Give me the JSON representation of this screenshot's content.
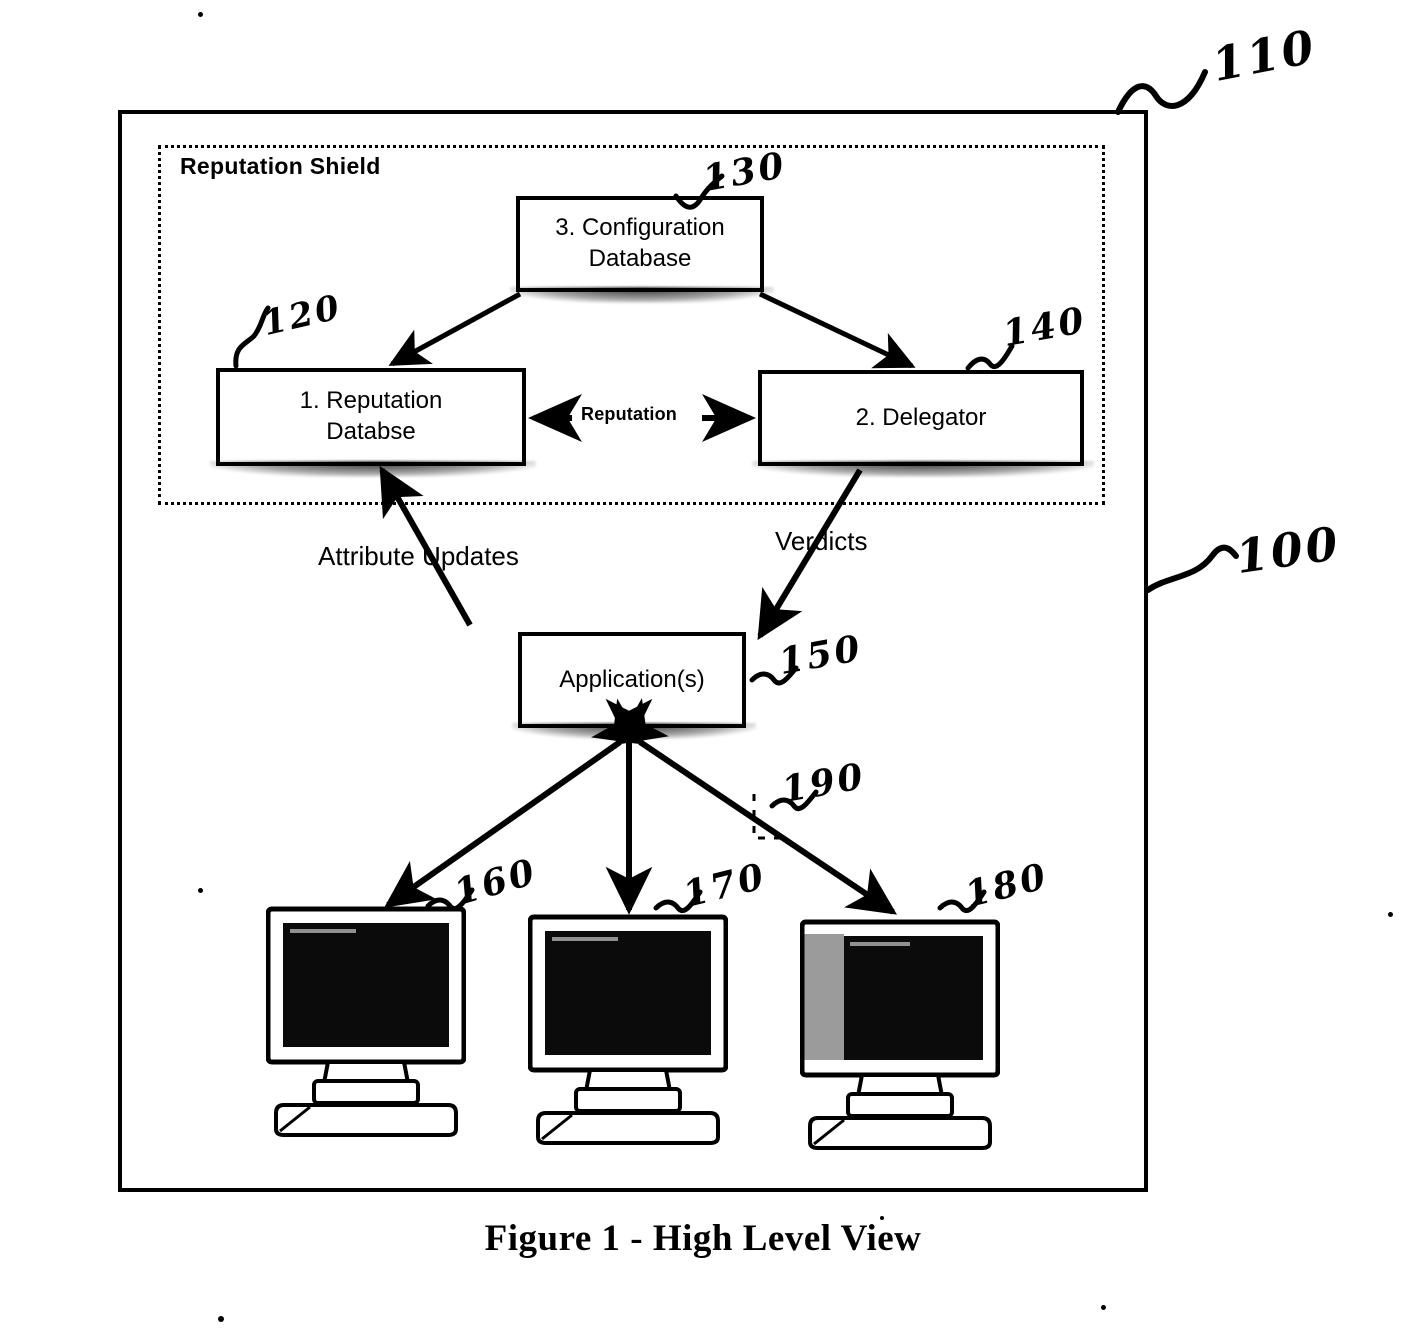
{
  "figure": {
    "caption": "Figure 1 - High Level View",
    "outer_frame_ref": "100",
    "shield_frame_ref": "110"
  },
  "shield": {
    "label": "Reputation Shield"
  },
  "boxes": [
    {
      "id": "config",
      "label": "3. Configuration\nDatabase",
      "line1": "3. Configuration",
      "line2": "Database",
      "ref": "130"
    },
    {
      "id": "repdb",
      "label": "1. Reputation\nDatabse",
      "line1": "1. Reputation",
      "line2": "Databse",
      "ref": "120"
    },
    {
      "id": "delegator",
      "label": "2. Delegator",
      "line1": "2. Delegator",
      "line2": "",
      "ref": "140"
    },
    {
      "id": "apps",
      "label": "Application(s)",
      "line1": "Application(s)",
      "line2": "",
      "ref": "150"
    }
  ],
  "flow_labels": {
    "reputation": "Reputation",
    "attribute_updates": "Attribute Updates",
    "verdicts": "Verdicts"
  },
  "reference_numerals": {
    "outer_system": "100",
    "shield_boundary": "110",
    "reputation_database": "120",
    "configuration_database": "130",
    "delegator": "140",
    "applications": "150",
    "client_left": "160",
    "client_center": "170",
    "client_right": "180",
    "network_link": "190"
  },
  "clients": [
    {
      "ref": "160",
      "name": "computer-left"
    },
    {
      "ref": "170",
      "name": "computer-center"
    },
    {
      "ref": "180",
      "name": "computer-right"
    }
  ],
  "colors": {
    "ink": "#000000",
    "paper": "#ffffff",
    "screen": "#0b0b0b"
  }
}
